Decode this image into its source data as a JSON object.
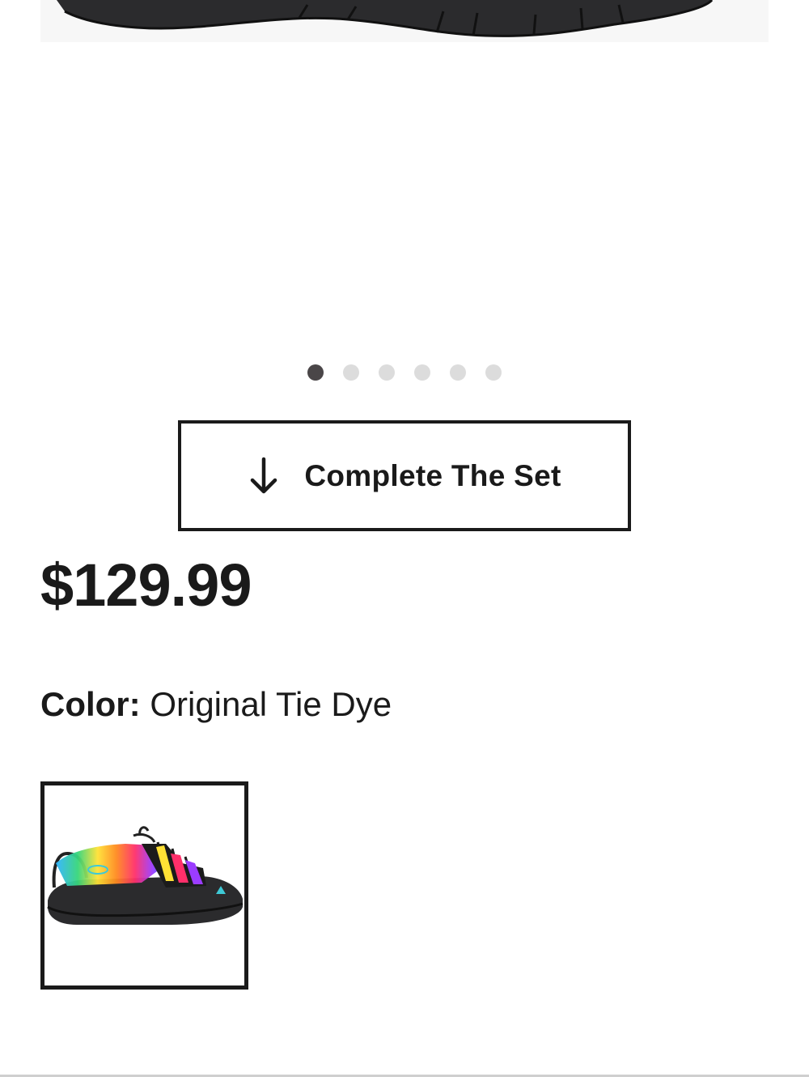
{
  "carousel": {
    "slide_count": 6,
    "active_index": 0
  },
  "complete_set": {
    "label": "Complete The Set",
    "icon": "arrow-down-icon"
  },
  "product": {
    "price": "$129.99",
    "color_label": "Color:",
    "color_value": "Original Tie Dye"
  },
  "swatches": [
    {
      "name": "Original Tie Dye",
      "selected": true
    }
  ],
  "colors": {
    "text": "#1a1a1a",
    "dot_active": "#4a4648",
    "dot_inactive": "#dcdcdc",
    "sole": "#2b2b2d"
  }
}
